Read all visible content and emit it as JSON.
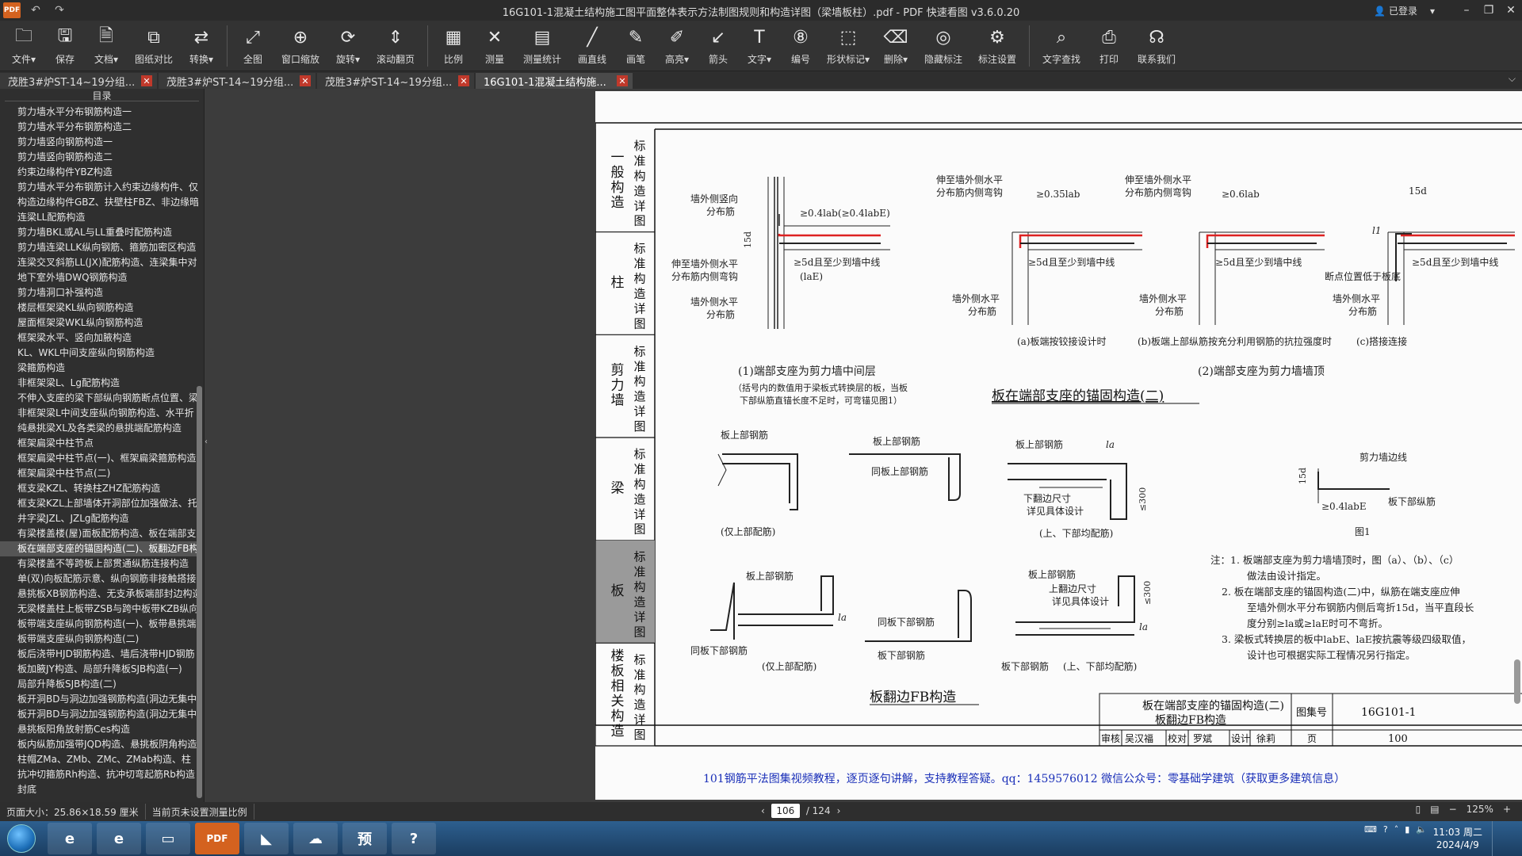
{
  "app": {
    "logo": "PDF",
    "title": "16G101-1混凝土结构施工图平面整体表示方法制图规则和构造详图（梁墙板柱）.pdf - PDF 快速看图 v3.6.0.20",
    "login": "已登录"
  },
  "toolbar": [
    {
      "label": "文件",
      "icon": "folder-icon",
      "glyph": "🗀",
      "dropdown": true
    },
    {
      "label": "保存",
      "icon": "save-icon",
      "glyph": "🖫",
      "dropdown": false
    },
    {
      "label": "文档",
      "icon": "document-icon",
      "glyph": "🗎",
      "dropdown": true
    },
    {
      "label": "图纸对比",
      "icon": "compare-icon",
      "glyph": "⧉",
      "dropdown": false
    },
    {
      "label": "转换",
      "icon": "convert-icon",
      "glyph": "⇄",
      "dropdown": true
    },
    {
      "sep": true
    },
    {
      "label": "全图",
      "icon": "fullview-icon",
      "glyph": "⤢",
      "dropdown": false
    },
    {
      "label": "窗口缩放",
      "icon": "zoom-window-icon",
      "glyph": "⊕",
      "dropdown": false
    },
    {
      "label": "旋转",
      "icon": "rotate-icon",
      "glyph": "⟳",
      "dropdown": true
    },
    {
      "label": "滚动翻页",
      "icon": "scroll-page-icon",
      "glyph": "⇕",
      "dropdown": false
    },
    {
      "sep": true
    },
    {
      "label": "比例",
      "icon": "scale-icon",
      "glyph": "▦",
      "dropdown": false
    },
    {
      "label": "测量",
      "icon": "measure-icon",
      "glyph": "✕",
      "dropdown": false
    },
    {
      "label": "测量统计",
      "icon": "measure-stats-icon",
      "glyph": "▤",
      "dropdown": false
    },
    {
      "label": "画直线",
      "icon": "line-icon",
      "glyph": "╱",
      "dropdown": false
    },
    {
      "label": "画笔",
      "icon": "pen-icon",
      "glyph": "✎",
      "dropdown": false
    },
    {
      "label": "高亮",
      "icon": "highlight-icon",
      "glyph": "✐",
      "dropdown": true
    },
    {
      "label": "箭头",
      "icon": "arrow-icon",
      "glyph": "↙",
      "dropdown": false
    },
    {
      "label": "文字",
      "icon": "text-icon",
      "glyph": "T",
      "dropdown": true
    },
    {
      "label": "编号",
      "icon": "number-icon",
      "glyph": "⑧",
      "dropdown": false
    },
    {
      "label": "形状标记",
      "icon": "shape-mark-icon",
      "glyph": "⬚",
      "dropdown": true
    },
    {
      "label": "删除",
      "icon": "eraser-icon",
      "glyph": "⌫",
      "dropdown": true
    },
    {
      "label": "隐藏标注",
      "icon": "hide-mark-icon",
      "glyph": "◎",
      "dropdown": false
    },
    {
      "label": "标注设置",
      "icon": "mark-settings-icon",
      "glyph": "⚙",
      "dropdown": false
    },
    {
      "sep": true
    },
    {
      "label": "文字查找",
      "icon": "search-icon",
      "glyph": "⌕",
      "dropdown": false
    },
    {
      "label": "打印",
      "icon": "print-icon",
      "glyph": "⎙",
      "dropdown": false
    },
    {
      "label": "联系我们",
      "icon": "headset-icon",
      "glyph": "☊",
      "dropdown": false
    }
  ],
  "tabs": [
    {
      "label": "茂胜3#炉ST-14~19分组..."
    },
    {
      "label": "茂胜3#炉ST-14~19分组..."
    },
    {
      "label": "茂胜3#炉ST-14~19分组..."
    },
    {
      "label": "16G101-1混凝土结构施...",
      "active": true
    }
  ],
  "sidebar": {
    "title": "目录",
    "items": [
      "剪力墙水平分布钢筋构造一",
      "剪力墙水平分布钢筋构造二",
      "剪力墙竖向钢筋构造一",
      "剪力墙竖向钢筋构造二",
      "约束边缘构件YBZ构造",
      "剪力墙水平分布钢筋计入约束边缘构件、仅",
      "构造边缘构件GBZ、扶壁柱FBZ、非边缘暗",
      "连梁LL配筋构造",
      "剪力墙BKL或AL与LL重叠时配筋构造",
      "剪力墙连梁LLK纵向钢筋、箍筋加密区构造",
      "连梁交叉斜筋LL(JX)配筋构造、连梁集中对",
      "地下室外墙DWQ钢筋构造",
      "剪力墙洞口补强构造",
      "楼层框架梁KL纵向钢筋构造",
      "屋面框架梁WKL纵向钢筋构造",
      "框架梁水平、竖向加腋构造",
      "KL、WKL中间支座纵向钢筋构造",
      "梁箍筋构造",
      "非框架梁L、Lg配筋构造",
      "不伸入支座的梁下部纵向钢筋断点位置、梁",
      "非框架梁L中间支座纵向钢筋构造、水平折",
      "纯悬挑梁XL及各类梁的悬挑端配筋构造",
      "框架扁梁中柱节点",
      "框架扁梁中柱节点(一)、框架扁梁箍筋构造",
      "框架扁梁中柱节点(二)",
      "框支梁KZL、转换柱ZHZ配筋构造",
      "框支梁KZL上部墙体开洞部位加强做法、托",
      "井字梁JZL、JZLg配筋构造",
      "有梁楼盖楼(屋)面板配筋构造、板在端部支",
      "板在端部支座的锚固构造(二)、板翻边FB构",
      "有梁楼盖不等跨板上部贯通纵筋连接构造",
      "单(双)向板配筋示意、纵向钢筋非接触搭接",
      "悬挑板XB钢筋构造、无支承板端部封边构造",
      "无梁楼盖柱上板带ZSB与跨中板带KZB纵向",
      "板带端支座纵向钢筋构造(一)、板带悬挑端",
      "板带端支座纵向钢筋构造(二)",
      "板后浇带HJD钢筋构造、墙后浇带HJD钢筋",
      "板加腋JY构造、局部升降板SJB构造(一)",
      "局部升降板SJB构造(二)",
      "板开洞BD与洞边加强钢筋构造(洞边无集中",
      "板开洞BD与洞边加强钢筋构造(洞边无集中",
      "悬挑板阳角放射筋Ces构造",
      "板内纵筋加强带JQD构造、悬挑板阴角构造",
      "柱帽ZMa、ZMb、ZMc、ZMab构造、柱",
      "抗冲切箍筋Rh构造、抗冲切弯起筋Rb构造",
      "封底"
    ],
    "active_index": 29
  },
  "drawing": {
    "side_left": [
      {
        "title": "一般构造",
        "sub": "标准构造详图"
      },
      {
        "title": "柱",
        "sub": "标准构造详图"
      },
      {
        "title": "剪力墙",
        "sub": "标准构造详图"
      },
      {
        "title": "梁",
        "sub": "标准构造详图"
      },
      {
        "title": "板",
        "sub": "标准构造详图",
        "active": true
      },
      {
        "title": "楼板相关构造",
        "sub": "标准构造详图"
      }
    ],
    "side_right": [
      "标准构造详图",
      "标准构造详图",
      "标准构造详图",
      "标准构造详图",
      "标准构造详图",
      "标准构造详图"
    ],
    "labels": {
      "wall_vertical": "墙外侧竖向",
      "dist_bar": "分布筋",
      "anchor1": "≥0.4lab(≥0.4labE)",
      "d15": "15d",
      "extend_horiz": "伸至墙外侧水平",
      "extend_horiz2": "分布筋内侧弯钩",
      "anchor_5d": "≥5d且至少到墙中线",
      "la_paren": "(laE)",
      "wall_horiz": "墙外侧水平",
      "anchor_035": "≥0.35lab",
      "anchor_06": "≥0.6lab",
      "cut_pos": "断点位置低于板底",
      "l1": "l1",
      "cap_a": "(a)板端按铰接设计时",
      "cap_b": "(b)板端上部纵筋按充分利用钢筋的抗拉强度时",
      "cap_c": "(c)搭接连接",
      "case1": "(1)端部支座为剪力墙中间层",
      "case1_note1": "（括号内的数值用于梁板式转换层的板，当板",
      "case1_note2": "下部纵筋直锚长度不足时，可弯锚见图1）",
      "case2": "(2)端部支座为剪力墙墙顶",
      "heading1": "板在端部支座的锚固构造(二)",
      "top_bar": "板上部钢筋",
      "top_only": "(仅上部配筋)",
      "same_top": "同板上部钢筋",
      "bottom_note1": "下翻边尺寸",
      "bottom_note2": "详见具体设计",
      "both": "(上、下部均配筋)",
      "le300": "≤300",
      "la": "la",
      "wall_line": "剪力墙边线",
      "bottom_long": "板下部纵筋",
      "anchor_e": "≥0.4labE",
      "fig1": "图1",
      "top_note1": "上翻边尺寸",
      "top_note2": "详见具体设计",
      "same_bottom": "同板下部钢筋",
      "bottom_bar": "板下部钢筋",
      "heading2": "板翻边FB构造"
    },
    "notes": [
      "注：1. 板端部支座为剪力墙墙顶时，图（a）、（b）、（c）",
      "做法由设计指定。",
      "2. 板在端部支座的锚固构造(二)中，纵筋在端支座应伸",
      "至墙外侧水平分布钢筋内侧后弯折15d，当平直段长",
      "度分别≥la或≥laE时可不弯折。",
      "3. 梁板式转换层的板中labE、laE按抗震等级四级取值，",
      "设计也可根据实际工程情况另行指定。"
    ],
    "titleblock": {
      "title1": "板在端部支座的锚固构造(二)",
      "title2": "板翻边FB构造",
      "atlas_label": "图集号",
      "atlas": "16G101-1",
      "review": "审核",
      "reviewer": "吴汉福",
      "check": "校对",
      "checker": "罗斌",
      "design": "设计",
      "designer": "徐莉",
      "page_label": "页",
      "page": "100"
    },
    "footer": "101钢筋平法图集视频教程，逐页逐句讲解，支持教程答疑。qq：1459576012  微信公众号：零基础学建筑（获取更多建筑信息）"
  },
  "status": {
    "page_size": "页面大小：25.86×18.59 厘米",
    "measure_scale": "当前页未设置测量比例",
    "current_page": "106",
    "total_pages": "/ 124",
    "zoom": "125%"
  },
  "taskbar": {
    "apps": [
      {
        "name": "browser-360-icon",
        "glyph": "e"
      },
      {
        "name": "ie-icon",
        "glyph": "e"
      },
      {
        "name": "explorer-icon",
        "glyph": "▭"
      },
      {
        "name": "pdf-viewer-icon",
        "glyph": "PDF"
      },
      {
        "name": "dingtalk-icon",
        "glyph": "◣"
      },
      {
        "name": "cloud-icon",
        "glyph": "☁"
      },
      {
        "name": "budget-app-icon",
        "glyph": "预"
      },
      {
        "name": "help-app-icon",
        "glyph": "?"
      }
    ],
    "time": "11:03 周二",
    "date": "2024/4/9"
  }
}
